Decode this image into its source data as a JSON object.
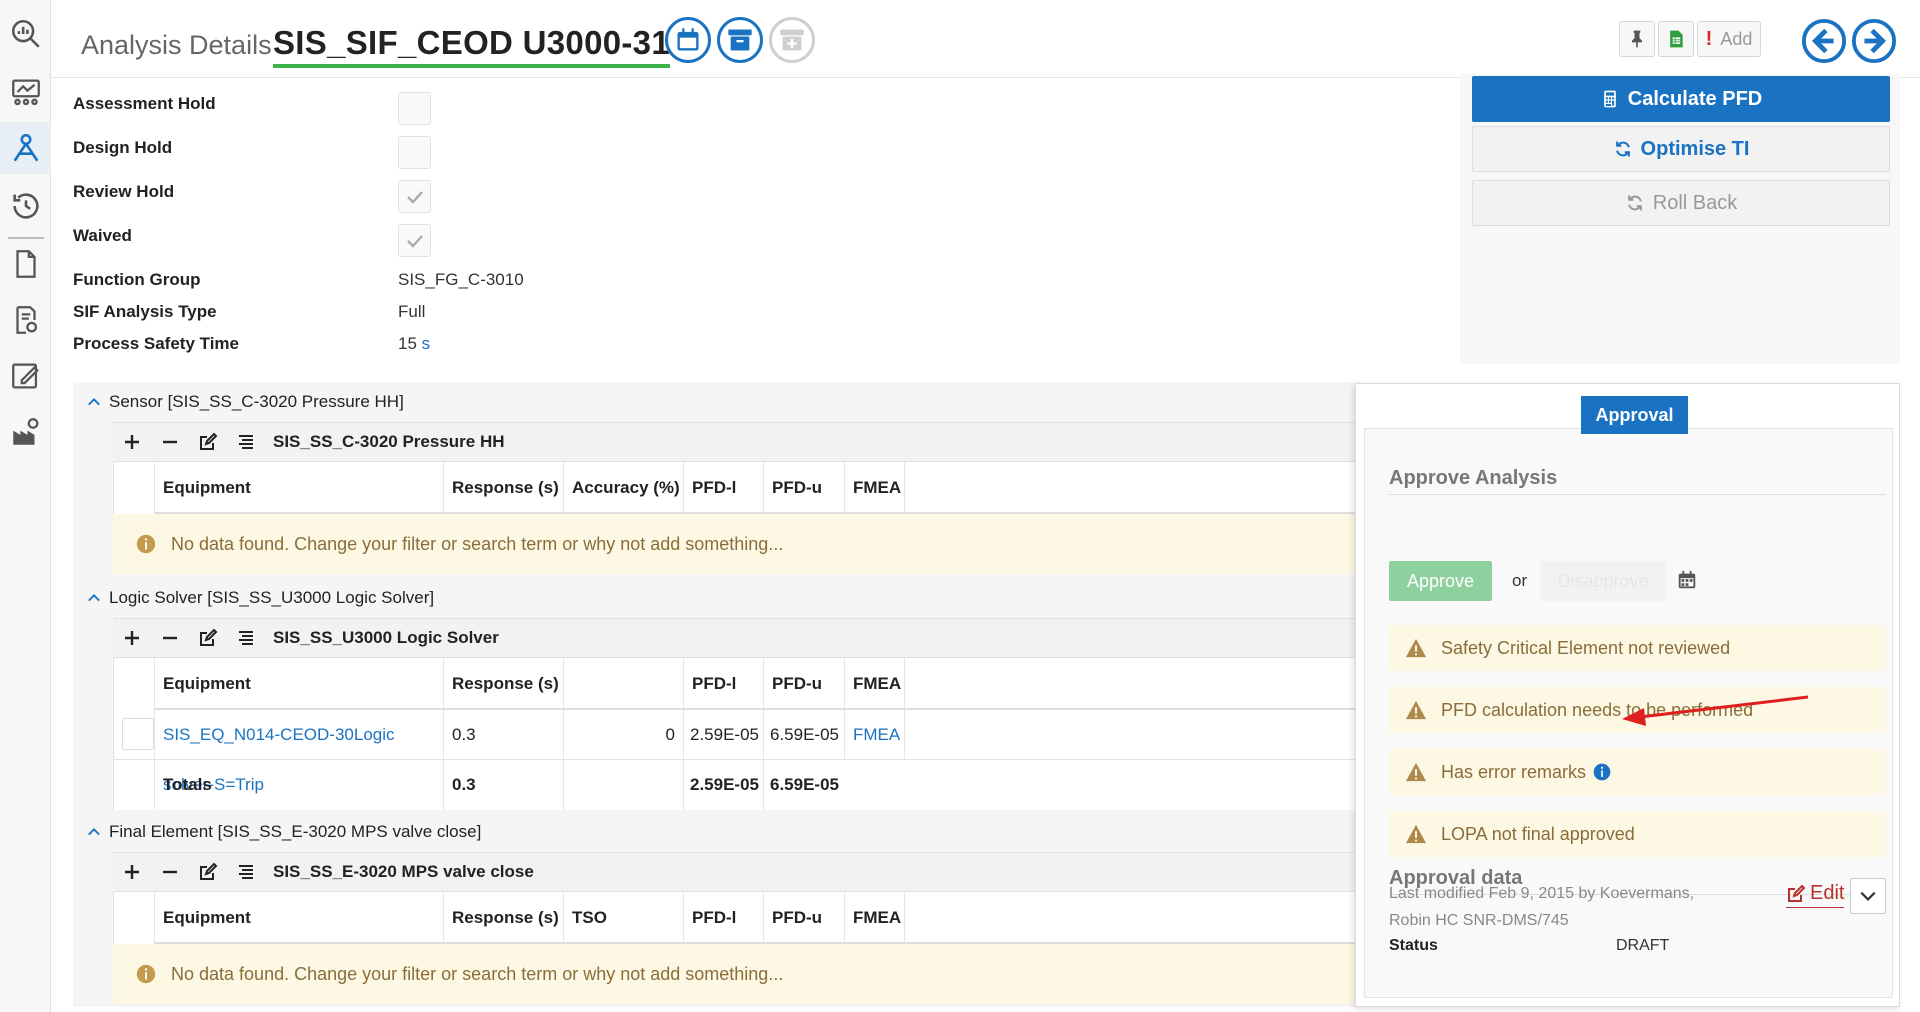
{
  "header": {
    "label": "Analysis Details",
    "title": "SIS_SIF_CEOD U3000-31",
    "add_label": "Add"
  },
  "form": {
    "assessment_hold": {
      "label": "Assessment Hold",
      "checked": false
    },
    "design_hold": {
      "label": "Design Hold",
      "checked": false
    },
    "review_hold": {
      "label": "Review Hold",
      "checked": true
    },
    "waived": {
      "label": "Waived",
      "checked": true
    },
    "function_group": {
      "label": "Function Group",
      "value": "SIS_FG_C-3010"
    },
    "sif_analysis_type": {
      "label": "SIF Analysis Type",
      "value": "Full"
    },
    "process_safety_time": {
      "label": "Process Safety Time",
      "value": "15",
      "unit": "s"
    }
  },
  "actions": {
    "calculate": "Calculate PFD",
    "optimise": "Optimise TI",
    "rollback": "Roll Back"
  },
  "sensor": {
    "header": "Sensor [SIS_SS_C-3020 Pressure HH]",
    "name": "SIS_SS_C-3020 Pressure HH",
    "columns": [
      "Equipment",
      "Response (s)",
      "Accuracy (%)",
      "PFD-l",
      "PFD-u",
      "FMEA"
    ],
    "empty": "No data found. Change your filter or search term or why not add something..."
  },
  "logic": {
    "header": "Logic Solver [SIS_SS_U3000 Logic Solver]",
    "name": "SIS_SS_U3000 Logic Solver",
    "columns": [
      "Equipment",
      "Response (s)",
      "",
      "PFD-l",
      "PFD-u",
      "FMEA"
    ],
    "row": {
      "equipment": "SIS_EQ_N014-CEOD-30Logic solver-S=Trip",
      "response": "0.3",
      "blank": "0",
      "pfd_l": "2.59E-05",
      "pfd_u": "6.59E-05",
      "fmea": "FMEA"
    },
    "totals": {
      "label": "Totals",
      "response": "0.3",
      "pfd_l": "2.59E-05",
      "pfd_u": "6.59E-05"
    }
  },
  "final": {
    "header": "Final Element [SIS_SS_E-3020 MPS valve close]",
    "name": "SIS_SS_E-3020 MPS valve close",
    "columns": [
      "Equipment",
      "Response (s)",
      "TSO",
      "PFD-l",
      "PFD-u",
      "FMEA"
    ],
    "empty": "No data found. Change your filter or search term or why not add something..."
  },
  "approval": {
    "tab": "Approval",
    "approve_heading": "Approve Analysis",
    "approve_btn": "Approve",
    "or": "or",
    "disapprove_btn": "Disapprove",
    "warnings": [
      "Safety Critical Element not reviewed",
      "PFD calculation needs to be performed",
      "Has error remarks",
      "LOPA not final approved"
    ],
    "data_heading": "Approval data",
    "meta_line1": "Last modified Feb 9, 2015 by Koevermans,",
    "meta_line2": "Robin HC SNR-DMS/745",
    "edit": "Edit",
    "status_label": "Status",
    "status_value": "DRAFT"
  },
  "colors": {
    "primary": "#1a72c2",
    "title_underline": "#3cb34a",
    "warning_bg": "#fcf8e3",
    "warning_text": "#8a6d3b",
    "annotation_arrow": "#e02020"
  }
}
